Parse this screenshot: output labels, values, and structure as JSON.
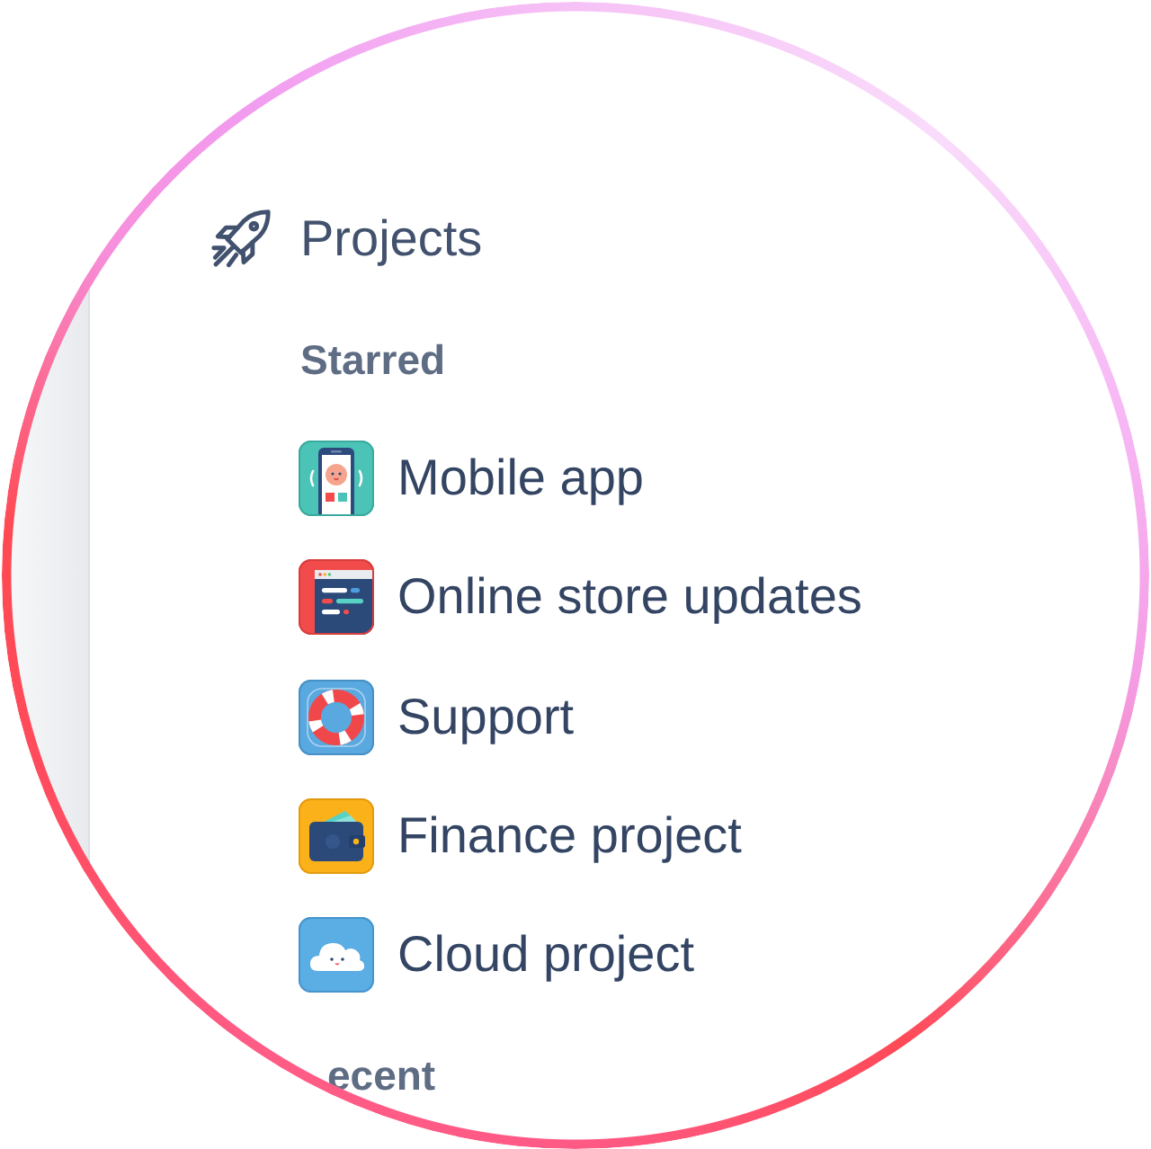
{
  "nav": {
    "title": "Projects"
  },
  "sections": [
    {
      "heading": "Starred",
      "items": [
        {
          "label": "Mobile app",
          "kind": "phone"
        },
        {
          "label": "Online store updates",
          "kind": "store"
        },
        {
          "label": "Support",
          "kind": "support"
        },
        {
          "label": "Finance project",
          "kind": "wallet"
        },
        {
          "label": "Cloud project",
          "kind": "cloud"
        }
      ]
    },
    {
      "heading": "ecent"
    }
  ]
}
